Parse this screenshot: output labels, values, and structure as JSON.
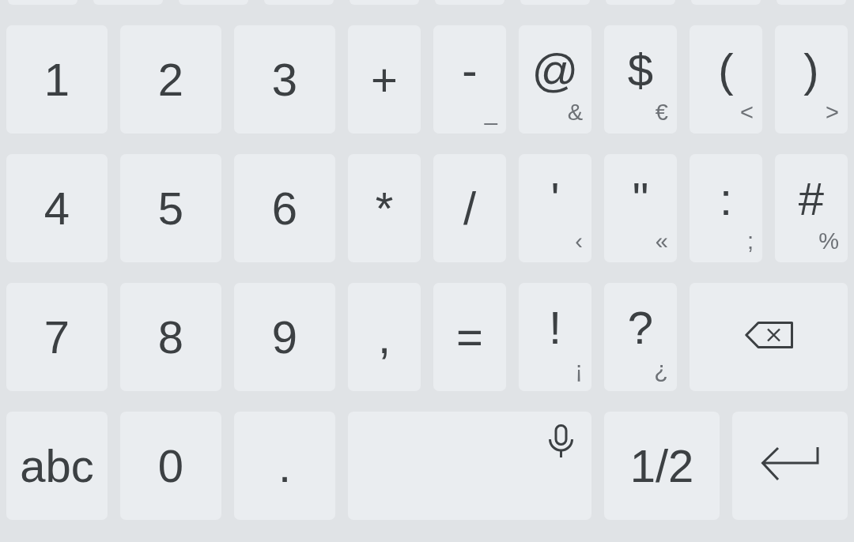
{
  "cut_off_keys": [
    {
      "kind": "key"
    },
    {
      "kind": "key"
    },
    {
      "kind": "key"
    },
    {
      "kind": "key"
    },
    {
      "kind": "key"
    },
    {
      "kind": "key"
    },
    {
      "kind": "key"
    },
    {
      "kind": "key"
    },
    {
      "kind": "key"
    },
    {
      "kind": "key"
    }
  ],
  "rows": [
    {
      "keys": [
        {
          "kind": "char",
          "label": "1"
        },
        {
          "kind": "char",
          "label": "2"
        },
        {
          "kind": "char",
          "label": "3"
        },
        {
          "kind": "char",
          "label": "+"
        },
        {
          "kind": "char",
          "label": "-",
          "hint": "_"
        },
        {
          "kind": "char",
          "label": "@",
          "hint": "&"
        },
        {
          "kind": "char",
          "label": "$",
          "hint": "€"
        },
        {
          "kind": "char",
          "label": "(",
          "hint": "<"
        },
        {
          "kind": "char",
          "label": ")",
          "hint": ">"
        }
      ]
    },
    {
      "keys": [
        {
          "kind": "char",
          "label": "4"
        },
        {
          "kind": "char",
          "label": "5"
        },
        {
          "kind": "char",
          "label": "6"
        },
        {
          "kind": "char",
          "label": "*"
        },
        {
          "kind": "char",
          "label": "/"
        },
        {
          "kind": "char",
          "label": "'",
          "hint": "‹"
        },
        {
          "kind": "char",
          "label": "\"",
          "hint": "«"
        },
        {
          "kind": "char",
          "label": ":",
          "hint": ";"
        },
        {
          "kind": "char",
          "label": "#",
          "hint": "%"
        }
      ]
    },
    {
      "keys": [
        {
          "kind": "char",
          "label": "7"
        },
        {
          "kind": "char",
          "label": "8"
        },
        {
          "kind": "char",
          "label": "9"
        },
        {
          "kind": "char",
          "label": ","
        },
        {
          "kind": "char",
          "label": "="
        },
        {
          "kind": "char",
          "label": "!",
          "hint": "¡"
        },
        {
          "kind": "char",
          "label": "?",
          "hint": "¿"
        },
        {
          "kind": "backspace"
        }
      ]
    },
    {
      "keys": [
        {
          "kind": "switch",
          "label": "abc"
        },
        {
          "kind": "char",
          "label": "0"
        },
        {
          "kind": "char",
          "label": "."
        },
        {
          "kind": "space"
        },
        {
          "kind": "switch",
          "label": "1/2"
        },
        {
          "kind": "enter"
        }
      ]
    }
  ]
}
